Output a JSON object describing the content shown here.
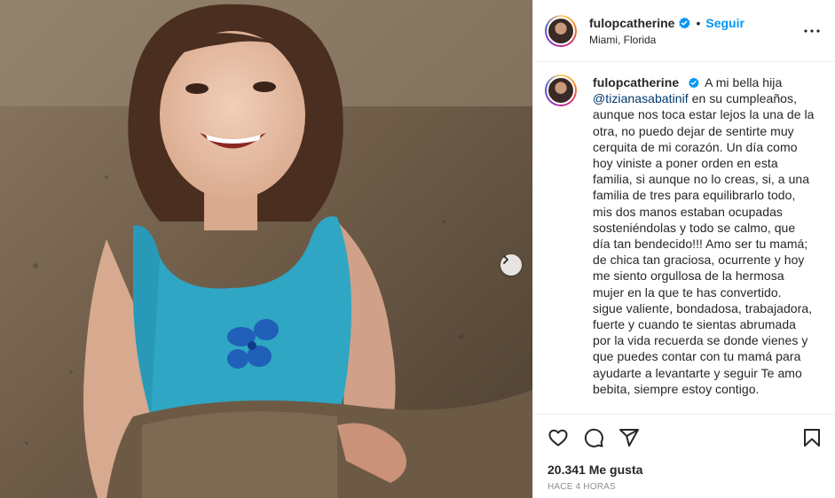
{
  "post": {
    "username": "fulopcatherine",
    "separator": "•",
    "follow_label": "Seguir",
    "location": "Miami, Florida",
    "caption_mention": "@tizianasabatinif",
    "caption_before": "A mi bella hija",
    "caption_after": "en su cumpleaños, aunque nos toca estar lejos la una de la otra, no puedo dejar de sentirte muy cerquita de mi corazón. Un día como hoy viniste a poner orden en esta familia, si aunque no lo creas, si, a una familia de tres para equilibrarlo todo, mis dos manos estaban ocupadas sosteniéndolas y todo se calmo, que día tan bendecido!!! Amo ser tu mamá; de chica tan graciosa, ocurrente y hoy me siento orgullosa de la hermosa mujer en la que te has convertido. sigue valiente, bondadosa, trabajadora, fuerte y cuando te sientas abrumada por la vida recuerda se donde vienes y que puedes contar con tu mamá para ayudarte a levantarte y seguir Te amo bebita, siempre estoy contigo.",
    "likes": "20.341 Me gusta",
    "timestamp": "HACE 4 HORAS"
  },
  "icons": {
    "verified": "verified-badge-icon",
    "more": "more-options-icon",
    "like": "heart-icon",
    "comment": "comment-icon",
    "share": "paper-plane-icon",
    "save": "bookmark-icon",
    "next": "chevron-right-icon"
  },
  "colors": {
    "follow": "#0095f6",
    "verified": "#0095f6",
    "mention": "#00376b",
    "text": "#262626",
    "muted": "#8e8e8e"
  }
}
